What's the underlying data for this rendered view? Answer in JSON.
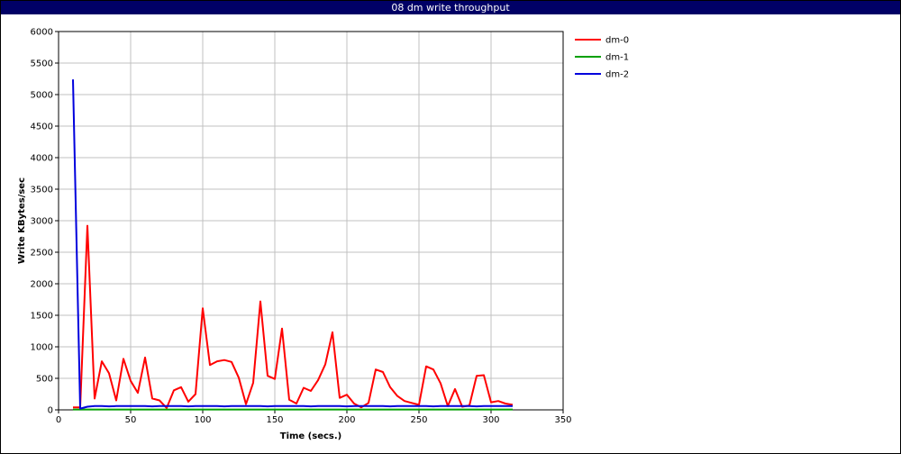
{
  "chart_data": {
    "type": "line",
    "title": "08 dm write throughput",
    "xlabel": "Time (secs.)",
    "ylabel": "Write KBytes/sec",
    "xlim": [
      0,
      350
    ],
    "ylim": [
      0,
      6000
    ],
    "xticks": [
      0,
      50,
      100,
      150,
      200,
      250,
      300,
      350
    ],
    "yticks": [
      0,
      500,
      1000,
      1500,
      2000,
      2500,
      3000,
      3500,
      4000,
      4500,
      5000,
      5500,
      6000
    ],
    "grid": true,
    "legend_position": "right",
    "series": [
      {
        "name": "dm-0",
        "color": "#ff0000",
        "x": [
          10,
          15,
          20,
          25,
          30,
          35,
          40,
          45,
          50,
          55,
          60,
          65,
          70,
          75,
          80,
          85,
          90,
          95,
          100,
          105,
          110,
          115,
          120,
          125,
          130,
          135,
          140,
          145,
          150,
          155,
          160,
          165,
          170,
          175,
          180,
          185,
          190,
          195,
          200,
          205,
          210,
          215,
          220,
          225,
          230,
          235,
          240,
          245,
          250,
          255,
          260,
          265,
          270,
          275,
          280,
          285,
          290,
          295,
          300,
          305,
          310,
          315
        ],
        "y": [
          40,
          40,
          2920,
          180,
          770,
          580,
          150,
          810,
          460,
          270,
          830,
          180,
          150,
          30,
          310,
          360,
          130,
          250,
          1610,
          710,
          770,
          790,
          760,
          510,
          90,
          430,
          1720,
          540,
          490,
          1290,
          160,
          100,
          350,
          300,
          470,
          720,
          1230,
          190,
          240,
          100,
          40,
          110,
          640,
          600,
          360,
          220,
          140,
          110,
          80,
          690,
          640,
          420,
          60,
          330,
          50,
          70,
          540,
          550,
          120,
          140,
          100,
          80
        ]
      },
      {
        "name": "dm-1",
        "color": "#00a000",
        "x": [
          10,
          15,
          20,
          25,
          30,
          35,
          40,
          45,
          50,
          55,
          60,
          65,
          70,
          75,
          80,
          85,
          90,
          95,
          100,
          105,
          110,
          115,
          120,
          125,
          130,
          135,
          140,
          145,
          150,
          155,
          160,
          165,
          170,
          175,
          180,
          185,
          190,
          195,
          200,
          205,
          210,
          215,
          220,
          225,
          230,
          235,
          240,
          245,
          250,
          255,
          260,
          265,
          270,
          275,
          280,
          285,
          290,
          295,
          300,
          305,
          310,
          315
        ],
        "y": [
          5,
          5,
          5,
          5,
          5,
          5,
          5,
          5,
          5,
          5,
          5,
          5,
          5,
          5,
          5,
          5,
          5,
          5,
          5,
          5,
          5,
          5,
          5,
          5,
          5,
          5,
          5,
          5,
          5,
          5,
          5,
          5,
          5,
          5,
          5,
          5,
          5,
          5,
          5,
          5,
          5,
          5,
          5,
          5,
          5,
          5,
          5,
          5,
          5,
          5,
          5,
          5,
          5,
          5,
          5,
          5,
          5,
          5,
          5,
          5,
          5,
          5
        ]
      },
      {
        "name": "dm-2",
        "color": "#0000dd",
        "x": [
          10,
          15,
          20,
          25,
          30,
          35,
          40,
          45,
          50,
          55,
          60,
          65,
          70,
          75,
          80,
          85,
          90,
          95,
          100,
          105,
          110,
          115,
          120,
          125,
          130,
          135,
          140,
          145,
          150,
          155,
          160,
          165,
          170,
          175,
          180,
          185,
          190,
          195,
          200,
          205,
          210,
          215,
          220,
          225,
          230,
          235,
          240,
          245,
          250,
          255,
          260,
          265,
          270,
          275,
          280,
          285,
          290,
          295,
          300,
          305,
          310,
          315
        ],
        "y": [
          5240,
          20,
          50,
          60,
          60,
          55,
          60,
          60,
          60,
          60,
          60,
          55,
          60,
          60,
          60,
          60,
          55,
          60,
          60,
          60,
          60,
          55,
          60,
          60,
          60,
          60,
          60,
          55,
          60,
          60,
          60,
          60,
          60,
          55,
          60,
          60,
          60,
          60,
          55,
          60,
          60,
          60,
          60,
          60,
          55,
          60,
          60,
          60,
          60,
          60,
          55,
          60,
          60,
          60,
          60,
          60,
          55,
          60,
          60,
          60,
          60,
          60
        ]
      }
    ]
  }
}
